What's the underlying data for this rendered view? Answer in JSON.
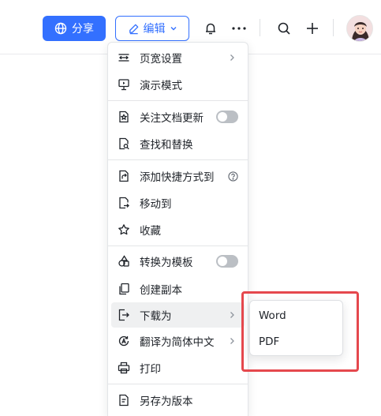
{
  "toolbar": {
    "share_label": "分享",
    "edit_label": "编辑",
    "accent_color": "#3370ff"
  },
  "menu": {
    "items": [
      {
        "label": "页宽设置",
        "icon": "page-width-icon",
        "suffix": "chevron"
      },
      {
        "label": "演示模式",
        "icon": "presentation-icon"
      },
      {
        "label": "关注文档更新",
        "icon": "follow-doc-icon",
        "suffix": "toggle",
        "toggle_on": false
      },
      {
        "label": "查找和替换",
        "icon": "find-replace-icon"
      },
      {
        "label": "添加快捷方式到",
        "icon": "shortcut-icon",
        "suffix": "help"
      },
      {
        "label": "移动到",
        "icon": "move-icon"
      },
      {
        "label": "收藏",
        "icon": "star-icon"
      },
      {
        "label": "转换为模板",
        "icon": "template-icon",
        "suffix": "toggle",
        "toggle_on": false
      },
      {
        "label": "创建副本",
        "icon": "copy-icon"
      },
      {
        "label": "下载为",
        "icon": "download-icon",
        "suffix": "chevron",
        "highlighted": true
      },
      {
        "label": "翻译为简体中文",
        "icon": "translate-icon",
        "suffix": "chevron"
      },
      {
        "label": "打印",
        "icon": "print-icon"
      },
      {
        "label": "另存为版本",
        "icon": "save-version-icon"
      }
    ]
  },
  "download_submenu": {
    "items": [
      {
        "label": "Word"
      },
      {
        "label": "PDF"
      }
    ],
    "highlight_color": "#e5484d"
  }
}
